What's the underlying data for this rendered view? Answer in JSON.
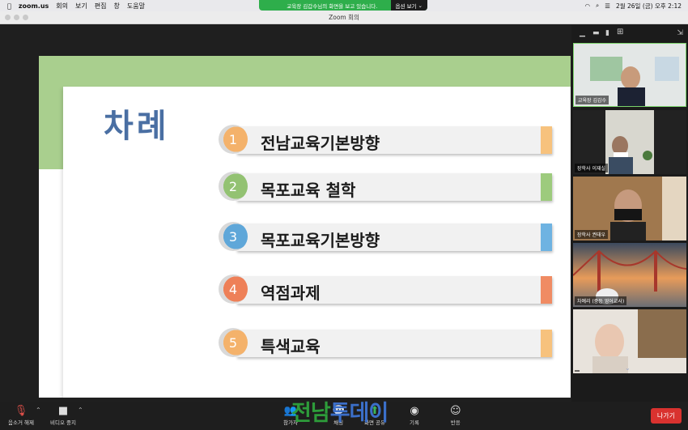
{
  "menubar": {
    "items": [
      "zoom.us",
      "회의",
      "보기",
      "편집",
      "창",
      "도움말"
    ],
    "datetime": "2월 26일 (금) 오후 2:12"
  },
  "share_banner": {
    "text": "교육장 김갑수님의 화면을 보고 있습니다.",
    "options": "옵션 보기"
  },
  "window_title": "Zoom 회의",
  "slide": {
    "title": "차례",
    "items": [
      {
        "num": "1",
        "label": "전남교육기본방향",
        "color": "#f4b26b",
        "tab": "#f7c27d"
      },
      {
        "num": "2",
        "label": "목포교육 철학",
        "color": "#93c272",
        "tab": "#9dcb7d"
      },
      {
        "num": "3",
        "label": "목포교육기본방향",
        "color": "#5fa7d9",
        "tab": "#6eb3e2"
      },
      {
        "num": "4",
        "label": "역점과제",
        "color": "#ee8058",
        "tab": "#f08b63"
      },
      {
        "num": "5",
        "label": "특색교육",
        "color": "#f4b26b",
        "tab": "#f7c27d"
      }
    ]
  },
  "participants": [
    {
      "name": "교육장 김갑수"
    },
    {
      "name": "장학사 이재실"
    },
    {
      "name": "장학사 권태우"
    },
    {
      "name": "차예리 (중등 영어교사)"
    },
    {
      "name": ""
    }
  ],
  "toolbar": {
    "mute": "음소거 해제",
    "video": "비디오 중지",
    "participants": "참가자",
    "chat": "채팅",
    "share": "화면 공유",
    "record": "기록",
    "reactions": "반응",
    "leave": "나가기"
  },
  "watermark": {
    "part1": "전남",
    "part2": "투데이"
  }
}
